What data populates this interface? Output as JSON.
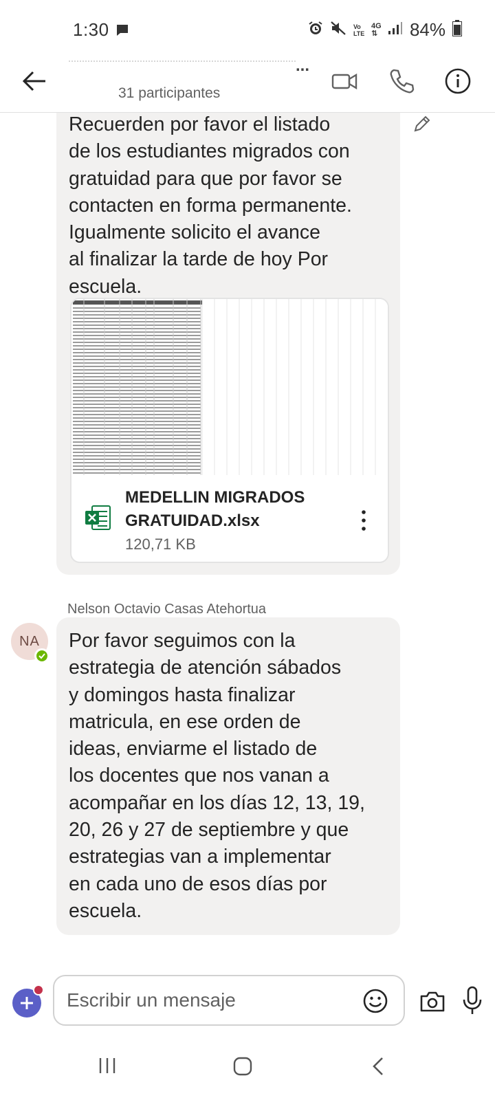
{
  "status_bar": {
    "time": "1:30",
    "battery": "84%",
    "network": "4G",
    "volte": "Vo LTE"
  },
  "header": {
    "participants": "31 participantes",
    "title_overflow": "..."
  },
  "messages": [
    {
      "lines": [
        "Recuerden por favor el listado",
        "de los estudiantes migrados con",
        "gratuidad para que por favor se",
        "contacten en forma permanente.",
        "Igualmente solicito el avance",
        "al finalizar la tarde de hoy Por",
        "escuela."
      ],
      "attachment": {
        "name_line1": "MEDELLIN MIGRADOS",
        "name_line2": "GRATUIDAD.xlsx",
        "size": "120,71 KB"
      }
    },
    {
      "sender": "Nelson Octavio Casas Atehortua",
      "initials": "NA",
      "lines": [
        "Por favor seguimos con la",
        "estrategia de atención sábados",
        "y domingos hasta finalizar",
        "matricula, en ese orden de",
        "ideas, enviarme el listado de",
        "los docentes que nos vanan a",
        "acompañar en los días 12, 13, 19,",
        "20, 26 y 27 de septiembre y que",
        "estrategias van a implementar",
        "en cada uno de esos días por",
        "escuela."
      ]
    }
  ],
  "composer": {
    "placeholder": "Escribir un mensaje"
  },
  "colors": {
    "bubble": "#f2f1f0",
    "accent": "#5b5fc7",
    "presence": "#6bb700",
    "excel": "#107c41"
  },
  "icons": [
    "back-arrow-icon",
    "video-call-icon",
    "phone-icon",
    "info-icon",
    "edit-icon",
    "excel-file-icon",
    "more-options-icon",
    "add-icon",
    "emoji-icon",
    "camera-icon",
    "microphone-icon",
    "recent-apps-icon",
    "home-icon",
    "back-icon"
  ]
}
